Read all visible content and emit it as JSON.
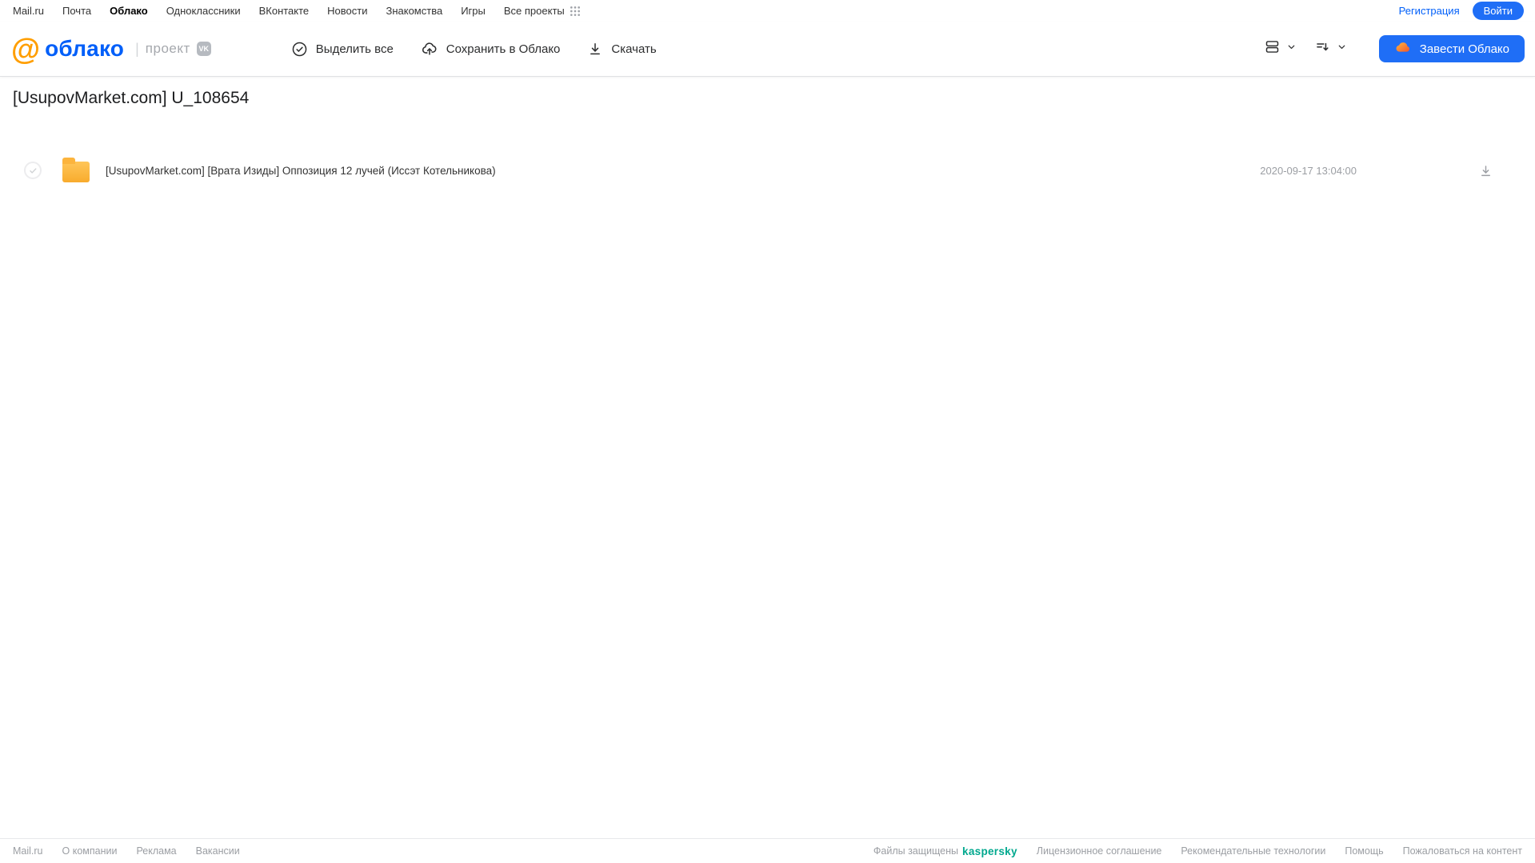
{
  "topnav": {
    "links": [
      "Mail.ru",
      "Почта",
      "Облако",
      "Одноклассники",
      "ВКонтакте",
      "Новости",
      "Знакомства",
      "Игры",
      "Все проекты"
    ],
    "active_link": "Облако",
    "registration_label": "Регистрация",
    "login_label": "Войти"
  },
  "header": {
    "logo_at": "@",
    "logo_text": "облако",
    "project_separator": "|",
    "project_label": "проект",
    "vk_badge": "VK",
    "toolbar": [
      {
        "label": "Выделить все",
        "icon": "check-circle"
      },
      {
        "label": "Сохранить в Облако",
        "icon": "cloud-upload"
      },
      {
        "label": "Скачать",
        "icon": "download-arrow"
      }
    ],
    "view_control_icon": "list-view",
    "sort_control_icon": "sort-lines",
    "create_cloud_label": "Завести Облако",
    "create_cloud_icon": "orange-cloud"
  },
  "main": {
    "title": "[UsupovMarket.com] U_108654",
    "files": [
      {
        "type": "folder",
        "name": "[UsupovMarket.com] [Врата Изиды] Оппозиция 12 лучей (Иссэт Котельникова)",
        "date": "2020-09-17 13:04:00",
        "download_icon": "download-arrow"
      }
    ]
  },
  "footer": {
    "left_links": [
      "Mail.ru",
      "О компании",
      "Реклама",
      "Вакансии"
    ],
    "protected_label": "Файлы защищены",
    "kaspersky_label": "kaspersky",
    "right_links": [
      "Лицензионное соглашение",
      "Рекомендательные технологии",
      "Помощь",
      "Пожаловаться на контент"
    ]
  },
  "colors": {
    "accent_blue": "#005ff9",
    "button_blue": "#1f6ef6",
    "folder_yellow": "#f8ab2d",
    "kaspersky_green": "#00a88e",
    "logo_orange": "#ff9e00",
    "icon_gray": "#2c2d2e",
    "muted_text": "#9b9ea3"
  }
}
